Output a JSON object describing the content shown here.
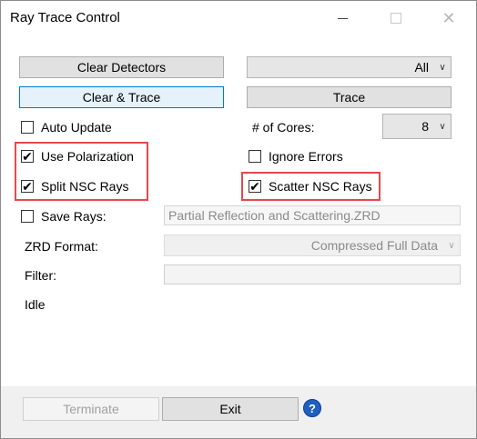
{
  "window": {
    "title": "Ray Trace Control"
  },
  "buttons": {
    "clear_detectors": "Clear Detectors",
    "clear_trace": "Clear & Trace",
    "trace": "Trace",
    "terminate": "Terminate",
    "exit": "Exit",
    "help_glyph": "?"
  },
  "dropdowns": {
    "detector_selection": "All",
    "cores_label": "# of Cores:",
    "cores_value": "8",
    "zrd_format_label": "ZRD Format:",
    "zrd_format_value": "Compressed Full Data"
  },
  "checkboxes": {
    "auto_update": {
      "label": "Auto Update",
      "checked": false
    },
    "use_polarization": {
      "label": "Use Polarization",
      "checked": true
    },
    "split_nsc_rays": {
      "label": "Split NSC Rays",
      "checked": true
    },
    "ignore_errors": {
      "label": "Ignore Errors",
      "checked": false
    },
    "scatter_nsc_rays": {
      "label": "Scatter NSC Rays",
      "checked": true
    },
    "save_rays": {
      "label": "Save Rays:",
      "checked": false
    }
  },
  "fields": {
    "save_rays_file": "Partial Reflection and Scattering.ZRD",
    "filter_label": "Filter:",
    "filter_value": ""
  },
  "status": {
    "text": "Idle"
  },
  "glyphs": {
    "check": "✔",
    "chevron": "∨",
    "close": "✕"
  },
  "colors": {
    "highlight": "#e5484d",
    "focus_border": "#0078d7",
    "help_blue": "#1f5fbf"
  },
  "icons": [
    "minimize-icon",
    "maximize-icon",
    "close-icon",
    "help-icon",
    "chevron-down-icon",
    "checkmark-icon"
  ]
}
